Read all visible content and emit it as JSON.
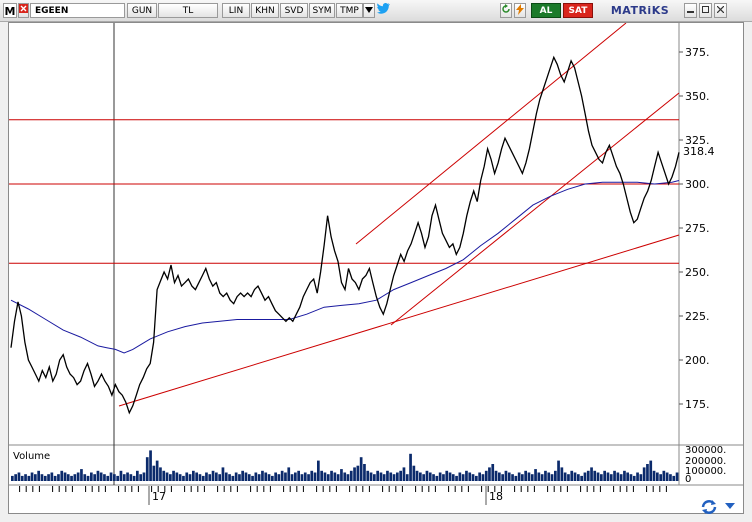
{
  "toolbar": {
    "logo": "M",
    "symbol": "EGEEN",
    "period": "GUN",
    "currency": "TL",
    "scale": "LIN",
    "khn": "KHN",
    "svd": "SVD",
    "sym": "SYM",
    "tmp": "TMP",
    "dropdown_icon": "triangle-down-icon",
    "twitter_icon": "twitter-icon",
    "refresh_icon": "refresh-icon",
    "lightning_icon": "lightning-icon",
    "buy_label": "AL",
    "sell_label": "SAT",
    "brand": "MATRiKS",
    "minimize_icon": "minimize-icon",
    "maximize_icon": "maximize-icon",
    "close_icon": "close-icon",
    "colors": {
      "buy": "#1b7a2a",
      "sell": "#d9251c",
      "brand": "#2c3a8a"
    }
  },
  "chart_data": {
    "type": "line",
    "series_colors": {
      "price": "#000000",
      "moving_average": "#1a1aa0",
      "volume": "#0b2a6b",
      "lines": "#cc0000"
    },
    "y_ticks": [
      "375.",
      "350.",
      "325.",
      "300.",
      "275.",
      "250.",
      "225.",
      "200.",
      "175."
    ],
    "current_price_label": "318.4",
    "ylim": [
      155,
      390
    ],
    "x_labels": [
      "17",
      "18"
    ],
    "horizontal_levels": [
      336.5,
      300,
      255
    ],
    "volume_label": "Volume",
    "volume_ticks": [
      "300000.",
      "200000.",
      "100000.",
      "0"
    ],
    "price": [
      [
        0,
        207
      ],
      [
        2,
        222
      ],
      [
        4,
        233
      ],
      [
        6,
        225
      ],
      [
        8,
        210
      ],
      [
        10,
        200
      ],
      [
        12,
        196
      ],
      [
        14,
        192
      ],
      [
        16,
        188
      ],
      [
        18,
        194
      ],
      [
        20,
        190
      ],
      [
        22,
        196
      ],
      [
        24,
        188
      ],
      [
        26,
        192
      ],
      [
        28,
        200
      ],
      [
        30,
        203
      ],
      [
        32,
        196
      ],
      [
        34,
        192
      ],
      [
        36,
        190
      ],
      [
        38,
        186
      ],
      [
        40,
        188
      ],
      [
        42,
        194
      ],
      [
        44,
        198
      ],
      [
        46,
        192
      ],
      [
        48,
        185
      ],
      [
        50,
        188
      ],
      [
        52,
        192
      ],
      [
        54,
        188
      ],
      [
        56,
        185
      ],
      [
        58,
        180
      ],
      [
        60,
        186
      ],
      [
        62,
        182
      ],
      [
        64,
        180
      ],
      [
        66,
        176
      ],
      [
        68,
        170
      ],
      [
        70,
        174
      ],
      [
        72,
        180
      ],
      [
        74,
        186
      ],
      [
        76,
        190
      ],
      [
        78,
        195
      ],
      [
        80,
        198
      ],
      [
        82,
        210
      ],
      [
        84,
        240
      ],
      [
        86,
        245
      ],
      [
        88,
        250
      ],
      [
        90,
        246
      ],
      [
        92,
        254
      ],
      [
        94,
        244
      ],
      [
        96,
        248
      ],
      [
        98,
        242
      ],
      [
        100,
        244
      ],
      [
        102,
        246
      ],
      [
        104,
        242
      ],
      [
        106,
        240
      ],
      [
        108,
        244
      ],
      [
        110,
        248
      ],
      [
        112,
        252
      ],
      [
        114,
        246
      ],
      [
        116,
        242
      ],
      [
        118,
        244
      ],
      [
        120,
        238
      ],
      [
        122,
        236
      ],
      [
        124,
        238
      ],
      [
        126,
        234
      ],
      [
        128,
        232
      ],
      [
        130,
        236
      ],
      [
        132,
        238
      ],
      [
        134,
        236
      ],
      [
        136,
        238
      ],
      [
        138,
        236
      ],
      [
        140,
        240
      ],
      [
        142,
        242
      ],
      [
        144,
        238
      ],
      [
        146,
        234
      ],
      [
        148,
        236
      ],
      [
        150,
        232
      ],
      [
        152,
        228
      ],
      [
        154,
        226
      ],
      [
        156,
        224
      ],
      [
        158,
        222
      ],
      [
        160,
        224
      ],
      [
        162,
        222
      ],
      [
        164,
        226
      ],
      [
        166,
        230
      ],
      [
        168,
        236
      ],
      [
        170,
        240
      ],
      [
        172,
        244
      ],
      [
        174,
        246
      ],
      [
        176,
        238
      ],
      [
        178,
        250
      ],
      [
        180,
        265
      ],
      [
        182,
        282
      ],
      [
        184,
        270
      ],
      [
        186,
        262
      ],
      [
        188,
        256
      ],
      [
        190,
        244
      ],
      [
        192,
        240
      ],
      [
        194,
        252
      ],
      [
        196,
        246
      ],
      [
        198,
        244
      ],
      [
        200,
        240
      ],
      [
        202,
        246
      ],
      [
        204,
        248
      ],
      [
        206,
        252
      ],
      [
        208,
        244
      ],
      [
        210,
        236
      ],
      [
        212,
        230
      ],
      [
        214,
        226
      ],
      [
        216,
        232
      ],
      [
        218,
        240
      ],
      [
        220,
        248
      ],
      [
        222,
        254
      ],
      [
        224,
        260
      ],
      [
        226,
        256
      ],
      [
        228,
        262
      ],
      [
        230,
        266
      ],
      [
        232,
        272
      ],
      [
        234,
        278
      ],
      [
        236,
        272
      ],
      [
        238,
        264
      ],
      [
        240,
        270
      ],
      [
        242,
        282
      ],
      [
        244,
        288
      ],
      [
        246,
        280
      ],
      [
        248,
        272
      ],
      [
        250,
        268
      ],
      [
        252,
        264
      ],
      [
        254,
        266
      ],
      [
        256,
        260
      ],
      [
        258,
        264
      ],
      [
        260,
        272
      ],
      [
        262,
        282
      ],
      [
        264,
        290
      ],
      [
        266,
        296
      ],
      [
        268,
        290
      ],
      [
        270,
        302
      ],
      [
        272,
        310
      ],
      [
        274,
        320
      ],
      [
        276,
        314
      ],
      [
        278,
        306
      ],
      [
        280,
        312
      ],
      [
        282,
        320
      ],
      [
        284,
        326
      ],
      [
        286,
        322
      ],
      [
        288,
        318
      ],
      [
        290,
        314
      ],
      [
        292,
        310
      ],
      [
        294,
        306
      ],
      [
        296,
        312
      ],
      [
        298,
        320
      ],
      [
        300,
        330
      ],
      [
        302,
        340
      ],
      [
        304,
        348
      ],
      [
        306,
        354
      ],
      [
        308,
        360
      ],
      [
        310,
        366
      ],
      [
        312,
        372
      ],
      [
        314,
        368
      ],
      [
        316,
        362
      ],
      [
        318,
        358
      ],
      [
        320,
        364
      ],
      [
        322,
        370
      ],
      [
        324,
        366
      ],
      [
        326,
        358
      ],
      [
        328,
        350
      ],
      [
        330,
        340
      ],
      [
        332,
        330
      ],
      [
        334,
        322
      ],
      [
        336,
        318
      ],
      [
        338,
        314
      ],
      [
        340,
        312
      ],
      [
        342,
        318
      ],
      [
        344,
        322
      ],
      [
        346,
        316
      ],
      [
        348,
        310
      ],
      [
        350,
        306
      ],
      [
        352,
        300
      ],
      [
        354,
        292
      ],
      [
        356,
        284
      ],
      [
        358,
        278
      ],
      [
        360,
        280
      ],
      [
        362,
        286
      ],
      [
        364,
        292
      ],
      [
        366,
        296
      ],
      [
        368,
        302
      ],
      [
        370,
        310
      ],
      [
        372,
        318
      ],
      [
        374,
        312
      ],
      [
        376,
        306
      ],
      [
        378,
        300
      ],
      [
        380,
        304
      ],
      [
        382,
        310
      ],
      [
        384,
        318
      ]
    ],
    "moving_average": [
      [
        0,
        234
      ],
      [
        10,
        229
      ],
      [
        20,
        223
      ],
      [
        30,
        217
      ],
      [
        40,
        213
      ],
      [
        50,
        208
      ],
      [
        55,
        207
      ],
      [
        60,
        206
      ],
      [
        65,
        204
      ],
      [
        70,
        206
      ],
      [
        75,
        209
      ],
      [
        80,
        212
      ],
      [
        90,
        216
      ],
      [
        100,
        219
      ],
      [
        110,
        221
      ],
      [
        120,
        222
      ],
      [
        130,
        223
      ],
      [
        140,
        223
      ],
      [
        150,
        223
      ],
      [
        160,
        223
      ],
      [
        170,
        226
      ],
      [
        180,
        230
      ],
      [
        190,
        231
      ],
      [
        200,
        232
      ],
      [
        210,
        234
      ],
      [
        220,
        240
      ],
      [
        230,
        244
      ],
      [
        240,
        248
      ],
      [
        250,
        252
      ],
      [
        260,
        257
      ],
      [
        270,
        265
      ],
      [
        280,
        272
      ],
      [
        290,
        280
      ],
      [
        300,
        288
      ],
      [
        310,
        293
      ],
      [
        320,
        297
      ],
      [
        330,
        300
      ],
      [
        340,
        301
      ],
      [
        350,
        301
      ],
      [
        360,
        301
      ],
      [
        370,
        300
      ],
      [
        380,
        301
      ],
      [
        384,
        302
      ]
    ],
    "volume": [
      3,
      4,
      5,
      3,
      4,
      3,
      5,
      4,
      6,
      4,
      3,
      4,
      5,
      3,
      4,
      6,
      5,
      4,
      3,
      4,
      5,
      7,
      4,
      3,
      5,
      4,
      6,
      5,
      4,
      3,
      5,
      4,
      3,
      6,
      4,
      5,
      4,
      3,
      6,
      4,
      5,
      14,
      18,
      9,
      12,
      8,
      6,
      5,
      4,
      6,
      5,
      4,
      3,
      5,
      4,
      6,
      5,
      4,
      3,
      5,
      4,
      6,
      5,
      4,
      8,
      5,
      4,
      3,
      5,
      4,
      6,
      5,
      4,
      3,
      5,
      4,
      6,
      5,
      4,
      3,
      5,
      4,
      6,
      5,
      8,
      4,
      5,
      6,
      4,
      5,
      4,
      6,
      5,
      12,
      6,
      5,
      4,
      6,
      5,
      4,
      7,
      5,
      4,
      6,
      8,
      9,
      14,
      10,
      6,
      5,
      4,
      6,
      5,
      4,
      6,
      5,
      4,
      5,
      6,
      8,
      4,
      16,
      9,
      6,
      5,
      4,
      6,
      5,
      4,
      3,
      5,
      4,
      6,
      5,
      4,
      3,
      5,
      4,
      6,
      5,
      4,
      3,
      5,
      4,
      6,
      8,
      10,
      6,
      5,
      4,
      6,
      5,
      4,
      3,
      5,
      4,
      6,
      5,
      4,
      7,
      5,
      4,
      6,
      5,
      4,
      6,
      12,
      8,
      5,
      4,
      6,
      5,
      4,
      3,
      5,
      6,
      8,
      6,
      5,
      4,
      6,
      5,
      4,
      6,
      5,
      4,
      6,
      5,
      4,
      3,
      5,
      4,
      8,
      10,
      12,
      6,
      5,
      4,
      6,
      5,
      4,
      3,
      5
    ]
  },
  "status": {
    "sync_icon": "sync-icon"
  }
}
